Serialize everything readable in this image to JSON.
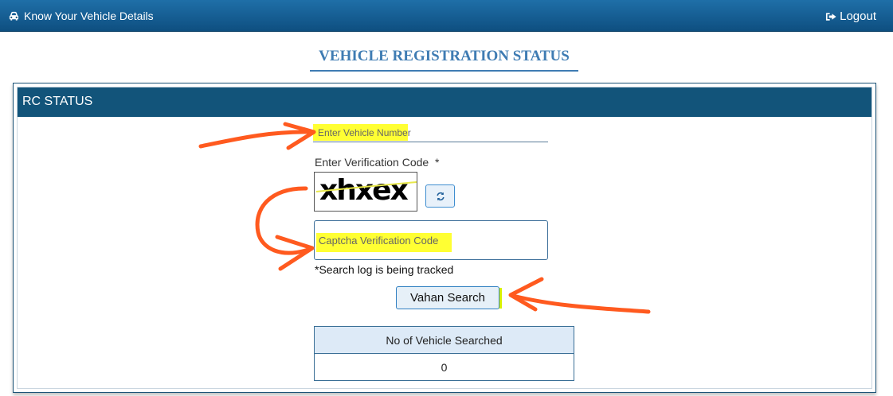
{
  "header": {
    "brand_label": "Know Your Vehicle Details",
    "brand_icon": "car-icon",
    "logout_label": "Logout",
    "logout_icon": "sign-out-icon",
    "bar_color": "#12547a"
  },
  "page": {
    "title": "VEHICLE REGISTRATION STATUS"
  },
  "panel": {
    "header_label": "RC STATUS"
  },
  "form": {
    "vehicle_placeholder": "Enter Vehicle Number",
    "verification_label": "Enter Verification Code  *",
    "captcha_text": "xhxex",
    "refresh_icon": "refresh-icon",
    "captcha_placeholder": "Captcha Verification Code",
    "tracking_note": "*Search log is being tracked",
    "search_label": "Vahan Search"
  },
  "stats": {
    "header": "No of Vehicle Searched",
    "value": "0"
  },
  "annotations": {
    "highlight_color": "#ffff33",
    "arrow_color": "#ff5a1f"
  }
}
